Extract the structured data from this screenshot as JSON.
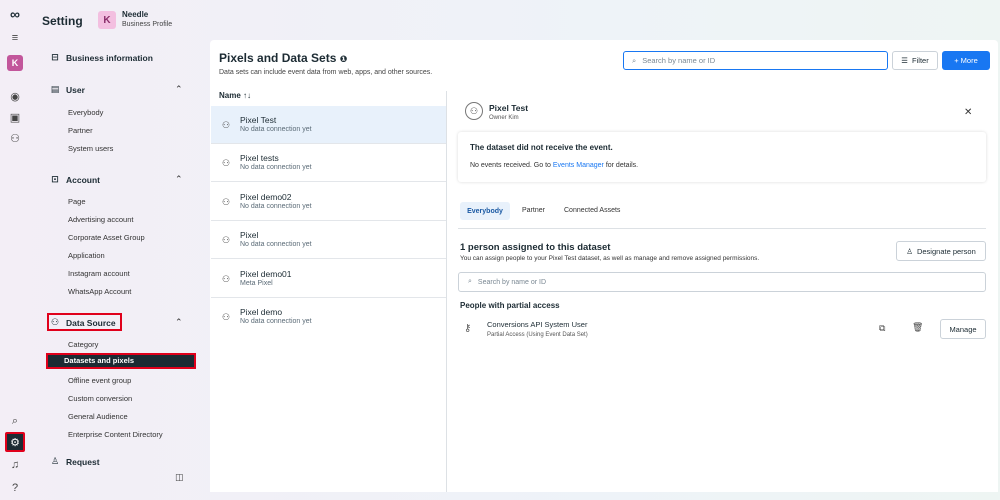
{
  "header": {
    "title": "Setting",
    "badge": "K",
    "business_name": "Needle",
    "business_sub": "Business Profile"
  },
  "rail": {
    "logo": "∞",
    "menu": "≡",
    "avatar": "K"
  },
  "sidebar": {
    "business": "Business information",
    "user": {
      "label": "User",
      "items": [
        "Everybody",
        "Partner",
        "System users"
      ]
    },
    "account": {
      "label": "Account",
      "items": [
        "Page",
        "Advertising account",
        "Corporate Asset Group",
        "Application",
        "Instagram account",
        "WhatsApp Account"
      ]
    },
    "datasource": {
      "label": "Data Source",
      "items": [
        "Category",
        "Datasets and pixels",
        "Offline event group",
        "Custom conversion",
        "General Audience",
        "Enterprise Content Directory"
      ]
    },
    "request": "Request"
  },
  "main": {
    "title": "Pixels and Data Sets",
    "subtitle": "Data sets can include event data from web, apps, and other sources.",
    "search_placeholder": "Search by name or ID",
    "filter": "Filter",
    "more": "+ More",
    "column_name": "Name ↑↓"
  },
  "list": [
    {
      "name": "Pixel Test",
      "status": "No data connection yet"
    },
    {
      "name": "Pixel tests",
      "status": "No data connection yet"
    },
    {
      "name": "Pixel demo02",
      "status": "No data connection yet"
    },
    {
      "name": "Pixel",
      "status": "No data connection yet"
    },
    {
      "name": "Pixel demo01",
      "status": "Meta Pixel"
    },
    {
      "name": "Pixel demo",
      "status": "No data connection yet"
    }
  ],
  "detail": {
    "title": "Pixel Test",
    "owner": "Owner Kim",
    "notice_title": "The dataset did not receive the event.",
    "notice_pre": "No events received. Go to ",
    "notice_link": "Events Manager",
    "notice_post": " for details.",
    "tabs": [
      "Everybody",
      "Partner",
      "Connected Assets"
    ],
    "assign_title": "1 person assigned to this dataset",
    "assign_body": "You can assign people to your Pixel Test dataset, as well as manage and remove assigned permissions.",
    "designate": "Designate person",
    "search_placeholder": "Search by name or ID",
    "partial_title": "People with partial access",
    "person_name": "Conversions API System User",
    "person_sub": "Partial Access (Using Event Data Set)",
    "manage": "Manage"
  }
}
